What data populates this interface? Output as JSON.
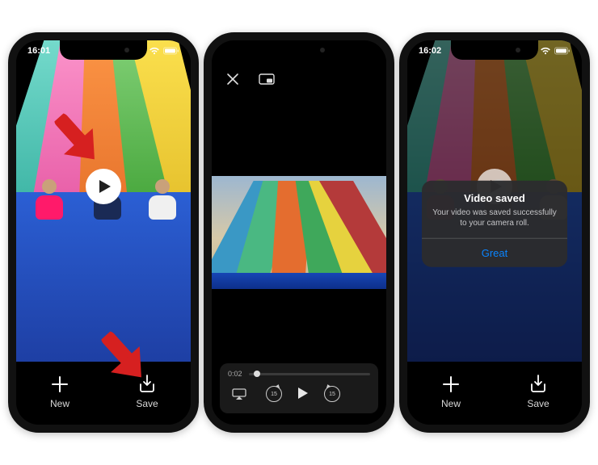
{
  "status": {
    "phone1_time": "16:01",
    "phone3_time": "16:02"
  },
  "bottom_bar": {
    "new_label": "New",
    "save_label": "Save"
  },
  "player": {
    "current_time": "0:02",
    "skip_seconds": "15"
  },
  "alert": {
    "title": "Video saved",
    "message": "Your video was saved successfully to your camera roll.",
    "button": "Great"
  }
}
